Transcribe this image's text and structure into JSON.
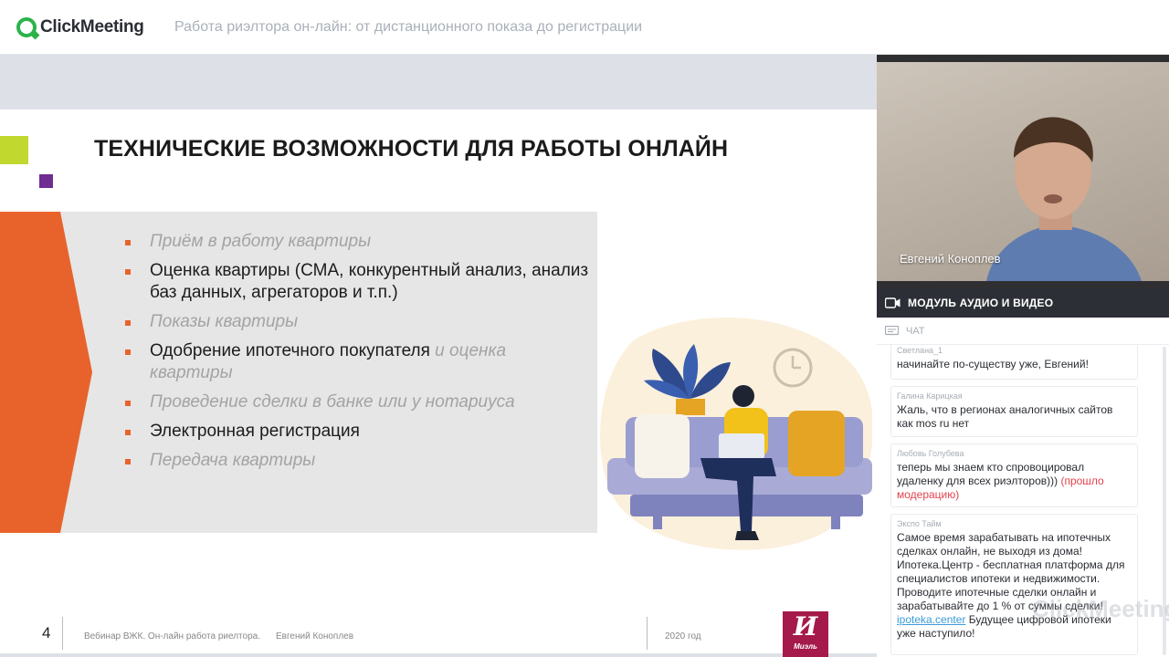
{
  "header": {
    "logo_text": "ClickMeeting",
    "webinar_title": "Работа риэлтора он-лайн: от дистанционного показа до регистрации"
  },
  "slide": {
    "heading": "ТЕХНИЧЕСКИЕ ВОЗМОЖНОСТИ ДЛЯ РАБОТЫ ОНЛАЙН",
    "bullets": [
      {
        "text": "Приём в работу квартиры",
        "style": "muted"
      },
      {
        "text": "Оценка квартиры (СМА, конкурентный анализ, анализ баз данных, агрегаторов и т.п.)",
        "style": "dark"
      },
      {
        "text": "Показы квартиры",
        "style": "muted"
      },
      {
        "text": "Одобрение ипотечного покупателя",
        "text_suffix": " и оценка квартиры",
        "style": "dark"
      },
      {
        "text": "Проведение сделки в банке или у нотариуса",
        "style": "muted"
      },
      {
        "text": "Электронная регистрация",
        "style": "dark"
      },
      {
        "text": "Передача квартиры",
        "style": "muted"
      }
    ],
    "footer": {
      "page_number": "4",
      "course": "Вебинар ВЖК. Он-лайн работа риелтора.",
      "author": "Евгений Коноплев",
      "year": "2020 год",
      "brand_mark": "И",
      "brand_name": "Миэль"
    },
    "colors": {
      "accent_orange": "#e8632b",
      "green": "#c1d82f",
      "purple": "#6f2c91",
      "brand": "#a51a4a"
    }
  },
  "video": {
    "participant_name": "Евгений Коноплев"
  },
  "av_module": {
    "label": "МОДУЛЬ АУДИО И ВИДЕО",
    "icon": "video-camera-icon"
  },
  "chat": {
    "label": "ЧАТ",
    "icon": "chat-icon",
    "messages": [
      {
        "author": "Светлана_1",
        "text": "начинайте по-существу уже, Евгений!"
      },
      {
        "author": "Галина Карицкая",
        "text": "Жаль, что в регионах аналогичных сайтов как mos ru нет"
      },
      {
        "author": "Любовь Голубева",
        "text": "теперь мы знаем кто спровоцировал удаленку для всех риэлторов)))",
        "note": " (прошло модерацию)"
      },
      {
        "author": "Экспо Тайм",
        "text": "Самое время зарабатывать на ипотечных сделках онлайн, не выходя из дома! Ипотека.Центр - бесплатная платформа для специалистов ипотеки и недвижимости. Проводите ипотечные сделки онлайн и зарабатывайте до 1 % от суммы сделки!",
        "link": "ipoteka.center",
        "text_after": " Будущее цифровой ипотеки уже наступило!"
      }
    ],
    "watermark": "ClickMeeting"
  }
}
